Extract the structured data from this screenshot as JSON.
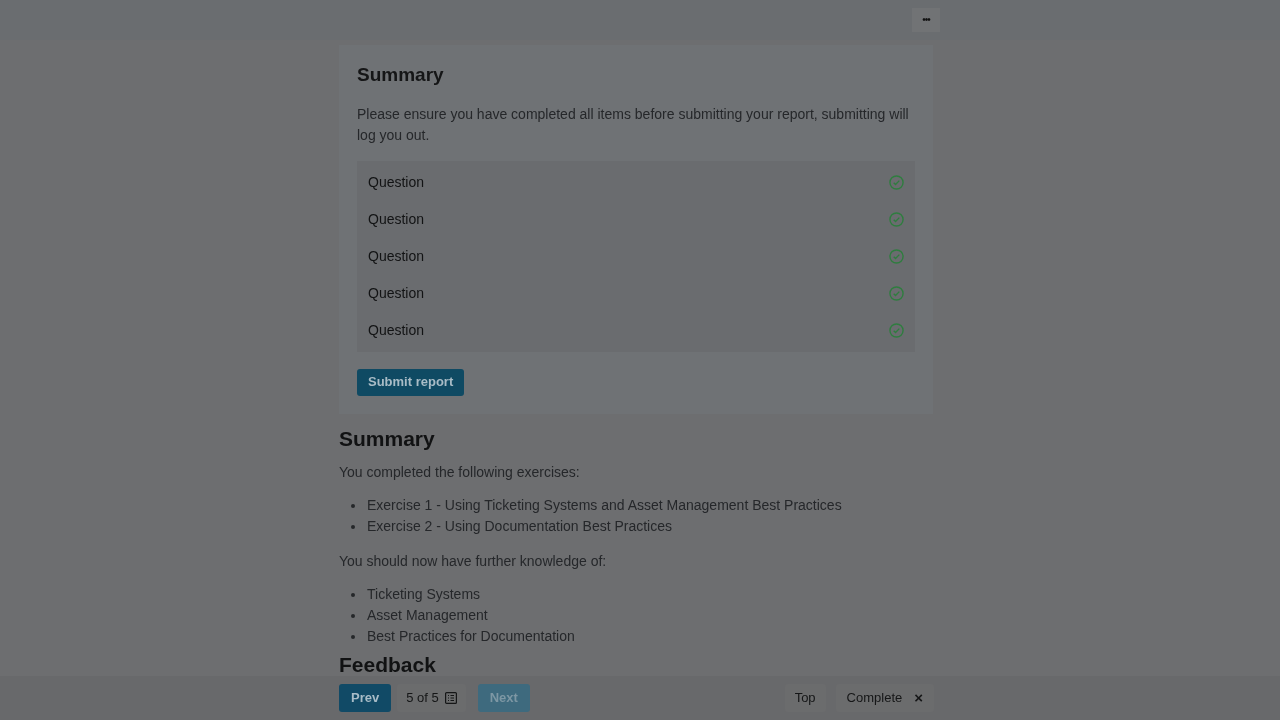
{
  "top_bar": {
    "menu_button": "•••"
  },
  "report_card": {
    "title": "Summary",
    "note": "Please ensure you have completed all items before submitting your report, submitting will log you out.",
    "questions": [
      {
        "label": "Question",
        "completed": true
      },
      {
        "label": "Question",
        "completed": true
      },
      {
        "label": "Question",
        "completed": true
      },
      {
        "label": "Question",
        "completed": true
      },
      {
        "label": "Question",
        "completed": true
      }
    ],
    "submit_button": "Submit report"
  },
  "summary": {
    "title": "Summary",
    "intro": "You completed the following exercises:",
    "exercises": [
      "Exercise 1 - Using Ticketing Systems and Asset Management Best Practices",
      "Exercise 2 - Using Documentation Best Practices"
    ],
    "knowledge_intro": "You should now have further knowledge of:",
    "knowledge": [
      "Ticketing Systems",
      "Asset Management",
      "Best Practices for Documentation"
    ],
    "next_heading": "Feedback"
  },
  "bottom_bar": {
    "prev": {
      "label": "Prev",
      "disabled": false
    },
    "page": "5 of 5",
    "next": {
      "label": "Next",
      "disabled": true
    },
    "top": "Top",
    "complete": "Complete",
    "close": "×"
  }
}
